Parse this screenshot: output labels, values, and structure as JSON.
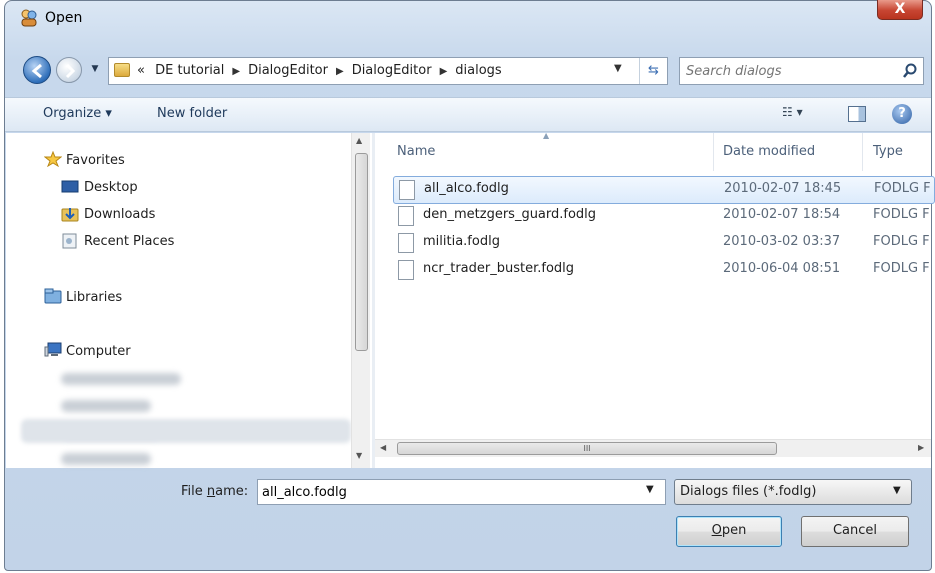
{
  "window": {
    "title": "Open",
    "close_glyph": "X"
  },
  "address": {
    "prefix": "«",
    "crumbs": [
      "DE tutorial",
      "DialogEditor",
      "DialogEditor",
      "dialogs"
    ]
  },
  "search": {
    "placeholder": "Search dialogs"
  },
  "toolbar": {
    "organize_label": "Organize ▾",
    "newfolder_label": "New folder",
    "views_glyph": "☷ ▾",
    "help_glyph": "?"
  },
  "nav": {
    "favorites_label": "Favorites",
    "favorites_items": [
      "Desktop",
      "Downloads",
      "Recent Places"
    ],
    "libraries_label": "Libraries",
    "computer_label": "Computer"
  },
  "files": {
    "columns": {
      "name": "Name",
      "date": "Date modified",
      "type": "Type"
    },
    "rows": [
      {
        "name": "all_alco.fodlg",
        "date": "2010-02-07 18:45",
        "type": "FODLG F",
        "selected": true
      },
      {
        "name": "den_metzgers_guard.fodlg",
        "date": "2010-02-07 18:54",
        "type": "FODLG F",
        "selected": false
      },
      {
        "name": "militia.fodlg",
        "date": "2010-03-02 03:37",
        "type": "FODLG F",
        "selected": false
      },
      {
        "name": "ncr_trader_buster.fodlg",
        "date": "2010-06-04 08:51",
        "type": "FODLG F",
        "selected": false
      }
    ],
    "scroll_grip": "III"
  },
  "bottom": {
    "filename_label_pre": "File ",
    "filename_label_u": "n",
    "filename_label_post": "ame:",
    "filename_value": "all_alco.fodlg",
    "filetype_value": "Dialogs files (*.fodlg)",
    "open_label_u": "O",
    "open_label_rest": "pen",
    "cancel_label": "Cancel"
  },
  "colors": {
    "selection": "#dcebfc",
    "frame": "#c7d8ec",
    "accent": "#3c7fb1"
  }
}
